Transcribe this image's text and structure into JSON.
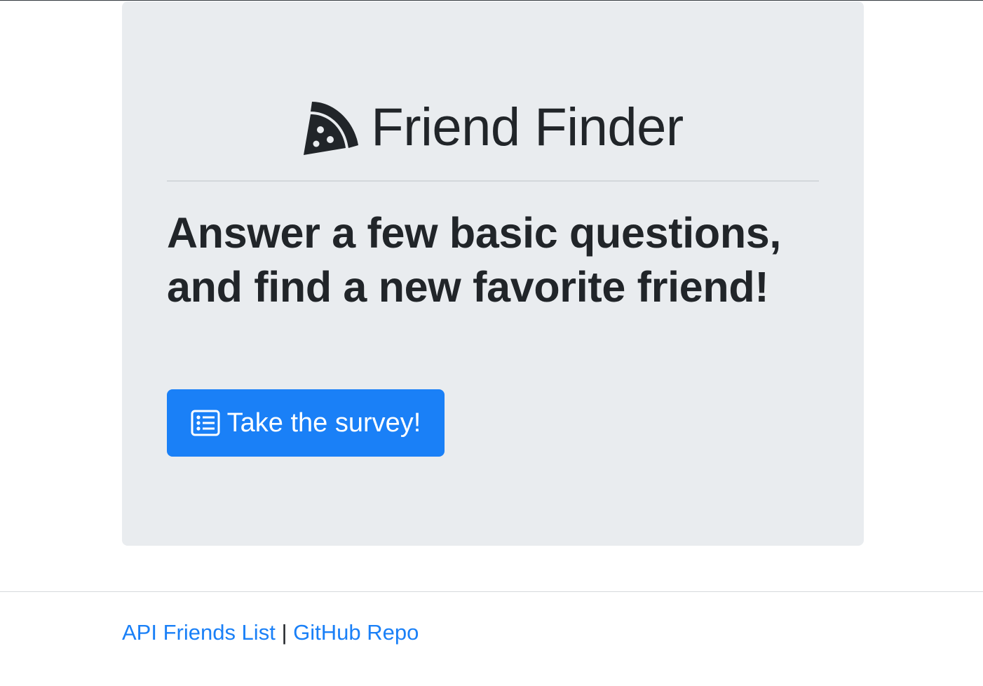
{
  "hero": {
    "brand_icon": "pizza-slice-icon",
    "title": "Friend Finder",
    "lead_line_1": "Answer a few basic questions,",
    "lead_line_2": "and find a new favorite friend!",
    "button_icon": "list-alt-icon",
    "button_label": "Take the survey!"
  },
  "footer": {
    "api_link": "API Friends List",
    "separator": "|",
    "github_link": "GitHub Repo"
  },
  "colors": {
    "jumbotron_bg": "#e9ecef",
    "primary": "#1a80f7",
    "text": "#212529"
  }
}
